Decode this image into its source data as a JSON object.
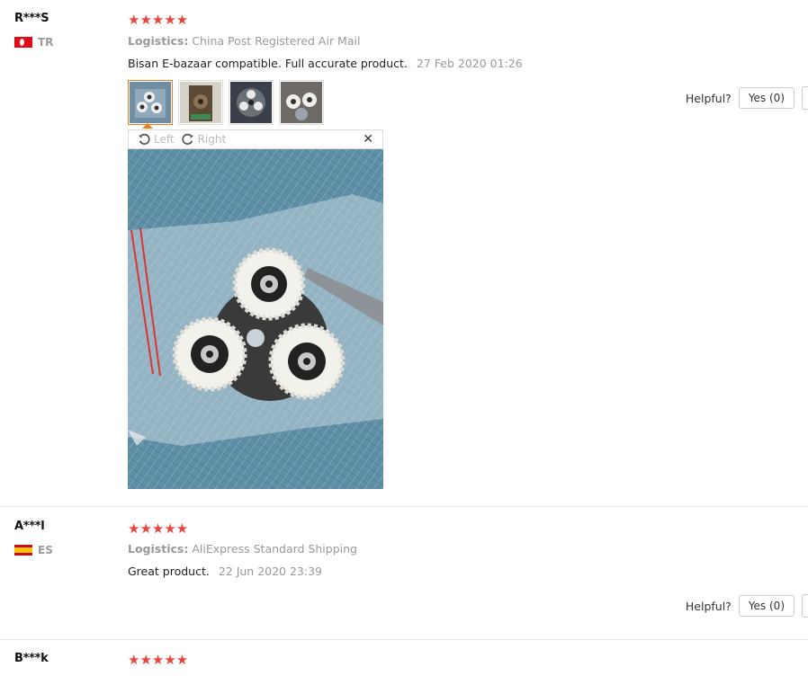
{
  "reviews": [
    {
      "user": "R***S",
      "country": "TR",
      "rating_stars": "★★★★★",
      "logistics_label": "Logistics:",
      "logistics_value": "China Post Registered Air Mail",
      "comment": "Bisan E-bazaar compatible. Full accurate product.",
      "date": "27 Feb 2020 01:26",
      "helpful_label": "Helpful?",
      "yes_label": "Yes (0)",
      "viewer": {
        "rotate_left": "Left",
        "rotate_right": "Right",
        "close": "✕"
      }
    },
    {
      "user": "A***l",
      "country": "ES",
      "rating_stars": "★★★★★",
      "logistics_label": "Logistics:",
      "logistics_value": "AliExpress Standard Shipping",
      "comment": "Great product.",
      "date": "22 Jun 2020 23:39",
      "helpful_label": "Helpful?",
      "yes_label": "Yes (0)"
    },
    {
      "user": "B***k",
      "rating_stars": "★★★★★"
    }
  ],
  "colors": {
    "star": "#e8453c",
    "active_thumb": "#e87e1e",
    "muted": "#999999"
  }
}
